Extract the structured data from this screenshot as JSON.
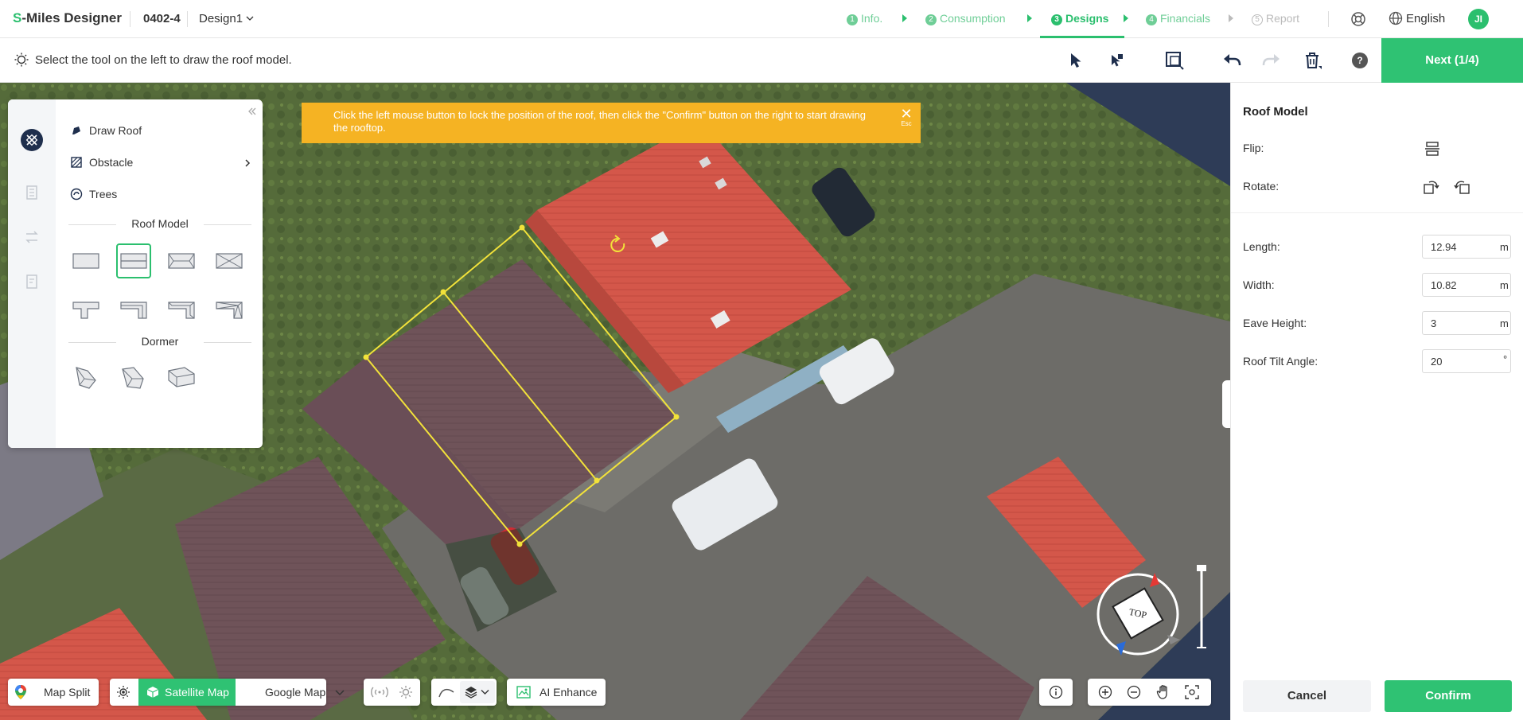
{
  "header": {
    "logo_prefix": "S",
    "logo_rest": "-Miles Designer",
    "project_id": "0402-4",
    "design_name": "Design1",
    "steps": [
      {
        "num": "1",
        "label": "Info.",
        "state": "done"
      },
      {
        "num": "2",
        "label": "Consumption",
        "state": "done"
      },
      {
        "num": "3",
        "label": "Designs",
        "state": "active"
      },
      {
        "num": "4",
        "label": "Financials",
        "state": "pending"
      },
      {
        "num": "5",
        "label": "Report",
        "state": "disabled"
      }
    ],
    "language": "English",
    "avatar_initials": "JI"
  },
  "toolbar": {
    "hint": "Select the tool on the left to draw the roof model.",
    "next_label": "Next (1/4)",
    "help_label": "?"
  },
  "banner": {
    "message": "Click the left mouse button to lock the position of the roof, then click the \"Confirm\" button on the right to start drawing the rooftop.",
    "close_hint": "Esc"
  },
  "tool_panel": {
    "items": [
      {
        "label": "Draw Roof"
      },
      {
        "label": "Obstacle"
      },
      {
        "label": "Trees"
      }
    ],
    "roof_model_title": "Roof Model",
    "dormer_title": "Dormer"
  },
  "right_panel": {
    "title": "Roof Model",
    "flip_label": "Flip:",
    "rotate_label": "Rotate:",
    "fields": [
      {
        "label": "Length:",
        "value": "12.94",
        "unit": "m"
      },
      {
        "label": "Width:",
        "value": "10.82",
        "unit": "m"
      },
      {
        "label": "Eave Height:",
        "value": "3",
        "unit": "m"
      },
      {
        "label": "Roof Tilt Angle:",
        "value": "20",
        "unit": "°"
      }
    ],
    "cancel_label": "Cancel",
    "confirm_label": "Confirm"
  },
  "map_controls": {
    "map_split": "Map Split",
    "satellite_map": "Satellite Map",
    "google_map": "Google Map",
    "ai_enhance": "AI Enhance",
    "compass_label": "TOP"
  },
  "colors": {
    "accent": "#2bbf6e",
    "banner": "#f5b323",
    "roof_outline": "#f2e23a"
  }
}
